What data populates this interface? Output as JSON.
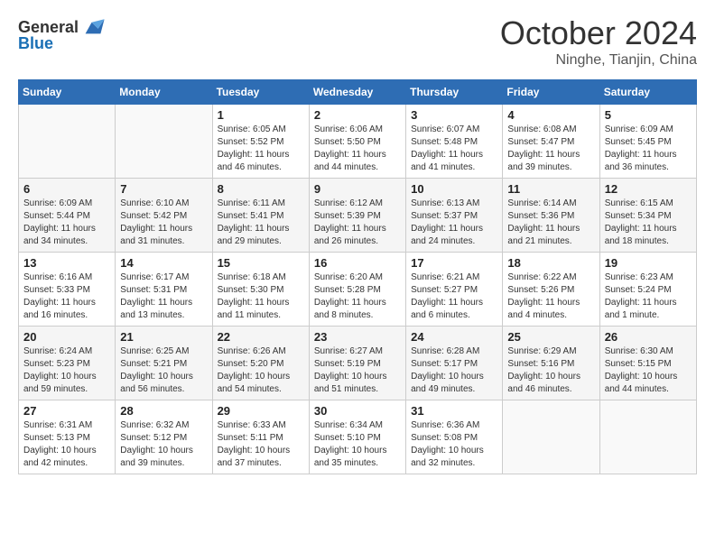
{
  "header": {
    "logo_general": "General",
    "logo_blue": "Blue",
    "month_title": "October 2024",
    "location": "Ninghe, Tianjin, China"
  },
  "days_of_week": [
    "Sunday",
    "Monday",
    "Tuesday",
    "Wednesday",
    "Thursday",
    "Friday",
    "Saturday"
  ],
  "weeks": [
    [
      {
        "day": "",
        "info": ""
      },
      {
        "day": "",
        "info": ""
      },
      {
        "day": "1",
        "info": "Sunrise: 6:05 AM\nSunset: 5:52 PM\nDaylight: 11 hours and 46 minutes."
      },
      {
        "day": "2",
        "info": "Sunrise: 6:06 AM\nSunset: 5:50 PM\nDaylight: 11 hours and 44 minutes."
      },
      {
        "day": "3",
        "info": "Sunrise: 6:07 AM\nSunset: 5:48 PM\nDaylight: 11 hours and 41 minutes."
      },
      {
        "day": "4",
        "info": "Sunrise: 6:08 AM\nSunset: 5:47 PM\nDaylight: 11 hours and 39 minutes."
      },
      {
        "day": "5",
        "info": "Sunrise: 6:09 AM\nSunset: 5:45 PM\nDaylight: 11 hours and 36 minutes."
      }
    ],
    [
      {
        "day": "6",
        "info": "Sunrise: 6:09 AM\nSunset: 5:44 PM\nDaylight: 11 hours and 34 minutes."
      },
      {
        "day": "7",
        "info": "Sunrise: 6:10 AM\nSunset: 5:42 PM\nDaylight: 11 hours and 31 minutes."
      },
      {
        "day": "8",
        "info": "Sunrise: 6:11 AM\nSunset: 5:41 PM\nDaylight: 11 hours and 29 minutes."
      },
      {
        "day": "9",
        "info": "Sunrise: 6:12 AM\nSunset: 5:39 PM\nDaylight: 11 hours and 26 minutes."
      },
      {
        "day": "10",
        "info": "Sunrise: 6:13 AM\nSunset: 5:37 PM\nDaylight: 11 hours and 24 minutes."
      },
      {
        "day": "11",
        "info": "Sunrise: 6:14 AM\nSunset: 5:36 PM\nDaylight: 11 hours and 21 minutes."
      },
      {
        "day": "12",
        "info": "Sunrise: 6:15 AM\nSunset: 5:34 PM\nDaylight: 11 hours and 18 minutes."
      }
    ],
    [
      {
        "day": "13",
        "info": "Sunrise: 6:16 AM\nSunset: 5:33 PM\nDaylight: 11 hours and 16 minutes."
      },
      {
        "day": "14",
        "info": "Sunrise: 6:17 AM\nSunset: 5:31 PM\nDaylight: 11 hours and 13 minutes."
      },
      {
        "day": "15",
        "info": "Sunrise: 6:18 AM\nSunset: 5:30 PM\nDaylight: 11 hours and 11 minutes."
      },
      {
        "day": "16",
        "info": "Sunrise: 6:20 AM\nSunset: 5:28 PM\nDaylight: 11 hours and 8 minutes."
      },
      {
        "day": "17",
        "info": "Sunrise: 6:21 AM\nSunset: 5:27 PM\nDaylight: 11 hours and 6 minutes."
      },
      {
        "day": "18",
        "info": "Sunrise: 6:22 AM\nSunset: 5:26 PM\nDaylight: 11 hours and 4 minutes."
      },
      {
        "day": "19",
        "info": "Sunrise: 6:23 AM\nSunset: 5:24 PM\nDaylight: 11 hours and 1 minute."
      }
    ],
    [
      {
        "day": "20",
        "info": "Sunrise: 6:24 AM\nSunset: 5:23 PM\nDaylight: 10 hours and 59 minutes."
      },
      {
        "day": "21",
        "info": "Sunrise: 6:25 AM\nSunset: 5:21 PM\nDaylight: 10 hours and 56 minutes."
      },
      {
        "day": "22",
        "info": "Sunrise: 6:26 AM\nSunset: 5:20 PM\nDaylight: 10 hours and 54 minutes."
      },
      {
        "day": "23",
        "info": "Sunrise: 6:27 AM\nSunset: 5:19 PM\nDaylight: 10 hours and 51 minutes."
      },
      {
        "day": "24",
        "info": "Sunrise: 6:28 AM\nSunset: 5:17 PM\nDaylight: 10 hours and 49 minutes."
      },
      {
        "day": "25",
        "info": "Sunrise: 6:29 AM\nSunset: 5:16 PM\nDaylight: 10 hours and 46 minutes."
      },
      {
        "day": "26",
        "info": "Sunrise: 6:30 AM\nSunset: 5:15 PM\nDaylight: 10 hours and 44 minutes."
      }
    ],
    [
      {
        "day": "27",
        "info": "Sunrise: 6:31 AM\nSunset: 5:13 PM\nDaylight: 10 hours and 42 minutes."
      },
      {
        "day": "28",
        "info": "Sunrise: 6:32 AM\nSunset: 5:12 PM\nDaylight: 10 hours and 39 minutes."
      },
      {
        "day": "29",
        "info": "Sunrise: 6:33 AM\nSunset: 5:11 PM\nDaylight: 10 hours and 37 minutes."
      },
      {
        "day": "30",
        "info": "Sunrise: 6:34 AM\nSunset: 5:10 PM\nDaylight: 10 hours and 35 minutes."
      },
      {
        "day": "31",
        "info": "Sunrise: 6:36 AM\nSunset: 5:08 PM\nDaylight: 10 hours and 32 minutes."
      },
      {
        "day": "",
        "info": ""
      },
      {
        "day": "",
        "info": ""
      }
    ]
  ]
}
